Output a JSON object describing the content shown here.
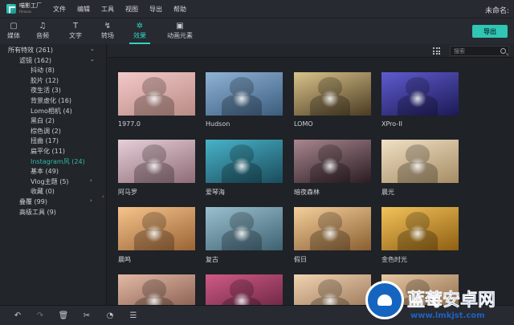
{
  "app": {
    "logo_name": "喵影工厂",
    "logo_sub": "Filmora",
    "doc_title": "未命名:"
  },
  "menu": [
    "文件",
    "编辑",
    "工具",
    "视图",
    "导出",
    "帮助"
  ],
  "tabs": [
    {
      "label": "媒体",
      "icon": "folder-icon",
      "glyph": "▢"
    },
    {
      "label": "音频",
      "icon": "music-note-icon",
      "glyph": "♫"
    },
    {
      "label": "文字",
      "icon": "text-icon",
      "glyph": "T"
    },
    {
      "label": "转场",
      "icon": "transition-icon",
      "glyph": "↯"
    },
    {
      "label": "效果",
      "icon": "effects-icon",
      "glyph": "✲"
    },
    {
      "label": "动画元素",
      "icon": "image-icon",
      "glyph": "▣"
    }
  ],
  "active_tab": "效果",
  "export_label": "导出",
  "search": {
    "placeholder": "搜索"
  },
  "sidebar": [
    {
      "label": "所有特效 (261)",
      "chevron": "⌄"
    },
    {
      "label": "滤镜 (162)",
      "chevron": "⌄"
    },
    {
      "label": "抖动 (8)"
    },
    {
      "label": "胶片 (12)"
    },
    {
      "label": "夜生活 (3)"
    },
    {
      "label": "背景虚化 (16)"
    },
    {
      "label": "Lomo相机 (4)"
    },
    {
      "label": "黑白 (2)"
    },
    {
      "label": "棕色调 (2)"
    },
    {
      "label": "扭曲 (17)"
    },
    {
      "label": "扁平化 (11)"
    },
    {
      "label": "Instagram风 (24)",
      "selected": true
    },
    {
      "label": "基本 (49)"
    },
    {
      "label": "Vlog主题 (5)",
      "chevron": "›"
    },
    {
      "label": "收藏 (0)"
    },
    {
      "label": "叠覆 (99)",
      "chevron": "›"
    },
    {
      "label": "高级工具 (9)"
    }
  ],
  "effects": [
    {
      "name": "1977.0",
      "tint": [
        "#f3c9c9",
        "#b98b84"
      ]
    },
    {
      "name": "Hudson",
      "tint": [
        "#8fb3d6",
        "#3c5c7d"
      ]
    },
    {
      "name": "LOMO",
      "tint": [
        "#d9c38b",
        "#4a3b22"
      ]
    },
    {
      "name": "XPro-II",
      "tint": [
        "#5f5bd0",
        "#1c1a54"
      ]
    },
    {
      "name": "阿马罗",
      "tint": [
        "#e6cfd8",
        "#8e6b77"
      ]
    },
    {
      "name": "爱琴海",
      "tint": [
        "#49b3c9",
        "#1a4c5c"
      ]
    },
    {
      "name": "暗夜森林",
      "tint": [
        "#a9868f",
        "#2a1c22"
      ]
    },
    {
      "name": "晨光",
      "tint": [
        "#f0e0c4",
        "#a58c64"
      ]
    },
    {
      "name": "晨鸣",
      "tint": [
        "#f6c48c",
        "#9a6335"
      ]
    },
    {
      "name": "复古",
      "tint": [
        "#9bc0d0",
        "#3e6272"
      ]
    },
    {
      "name": "假日",
      "tint": [
        "#f4cf9b",
        "#8a5f31"
      ]
    },
    {
      "name": "金色时光",
      "tint": [
        "#f2c35a",
        "#8f5e12"
      ]
    },
    {
      "name": "",
      "tint": [
        "#e3b9a6",
        "#7b5344"
      ]
    },
    {
      "name": "",
      "tint": [
        "#d05a86",
        "#5e1f3a"
      ]
    },
    {
      "name": "",
      "tint": [
        "#f1d3b2",
        "#8d6b4c"
      ]
    },
    {
      "name": "",
      "tint": [
        "#e8c7a3",
        "#7e5c3c"
      ]
    }
  ],
  "bottom_icons": [
    {
      "icon": "undo-icon",
      "glyph": "↶",
      "enabled": true
    },
    {
      "icon": "redo-icon",
      "glyph": "↷",
      "enabled": false
    },
    {
      "icon": "delete-icon",
      "glyph": "🗑",
      "enabled": true
    },
    {
      "icon": "cut-icon",
      "glyph": "✂",
      "enabled": true
    },
    {
      "icon": "speed-icon",
      "glyph": "◔",
      "enabled": true
    },
    {
      "icon": "adjust-icon",
      "glyph": "☰",
      "enabled": true
    }
  ],
  "watermark": {
    "title": "蓝莓安卓网",
    "url": "www.lmkjst.com"
  }
}
